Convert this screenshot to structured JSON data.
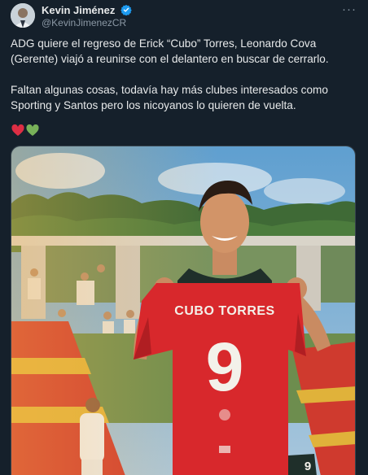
{
  "author": {
    "name": "Kevin Jiménez",
    "handle": "@KevinJimenezCR",
    "avatar_icon": "profile-avatar",
    "verified_icon": "verified-badge-icon",
    "verified_color": "#1d9bf0"
  },
  "more_label": "···",
  "tweet": {
    "paragraph1": "ADG quiere el regreso de Erick “Cubo” Torres, Leonardo Cova (Gerente) viajó a reunirse con el delantero en buscar de cerrarlo.",
    "paragraph2": "Faltan algunas cosas, todavía hay más clubes interesados como Sporting y Santos pero los nicoyanos lo quieren de vuelta.",
    "emojis": [
      "red-heart-icon",
      "green-heart-icon"
    ]
  },
  "media": {
    "jersey_name": "CUBO TORRES",
    "jersey_number": "9",
    "shorts_number": "9",
    "colors": {
      "background": "#15202b",
      "jersey": "#d8282c",
      "text": "#e7e9ea",
      "muted": "#8b98a5"
    }
  }
}
